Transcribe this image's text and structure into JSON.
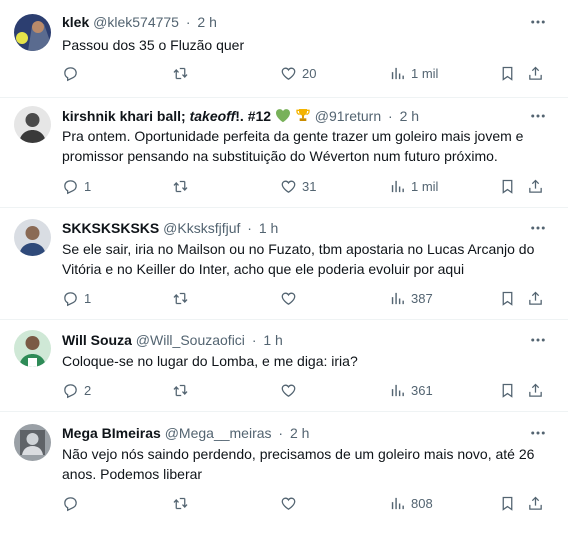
{
  "tweets": [
    {
      "name": "klek",
      "handle": "@klek574775",
      "time": "2 h",
      "text": "Passou dos 35 o Fluzão quer",
      "replies": "",
      "retweets": "",
      "likes": "20",
      "views": "1 mil"
    },
    {
      "name_plain": "kirshnik khari ball; ",
      "name_italic": "takeoff",
      "name_suffix": "!. #12",
      "badge_icons": [
        "green-heart-emoji",
        "trophy-emoji"
      ],
      "handle": "@91return",
      "time": "2 h",
      "text": "Pra ontem. Oportunidade perfeita da gente trazer um goleiro mais jovem e promissor pensando na substituição do Wéverton num futuro próximo.",
      "replies": "1",
      "retweets": "",
      "likes": "31",
      "views": "1 mil"
    },
    {
      "name": "SKKSKSKSKS",
      "handle": "@Kksksfjfjuf",
      "time": "1 h",
      "text": "Se ele sair, iria no Mailson ou no Fuzato, tbm apostaria no Lucas Arcanjo do Vitória e no Keiller do Inter, acho que ele poderia evoluir por aqui",
      "replies": "1",
      "retweets": "",
      "likes": "",
      "views": "387"
    },
    {
      "name": "Will Souza",
      "handle": "@Will_Souzaofici",
      "time": "1 h",
      "text": "Coloque-se no lugar do Lomba, e me diga: iria?",
      "replies": "2",
      "retweets": "",
      "likes": "",
      "views": "361"
    },
    {
      "name": "Mega BImeiras",
      "handle": "@Mega__meiras",
      "time": "2 h",
      "text": "Não vejo nós saindo perdendo, precisamos de um goleiro mais novo, até 26 anos. Podemos liberar",
      "replies": "",
      "retweets": "",
      "likes": "",
      "views": "808"
    }
  ],
  "separator_dot": "·",
  "colors": {
    "text_primary": "#0f1419",
    "text_secondary": "#536471",
    "divider": "#eff3f4",
    "green_heart": "#78b159",
    "trophy": "#f4b400"
  }
}
